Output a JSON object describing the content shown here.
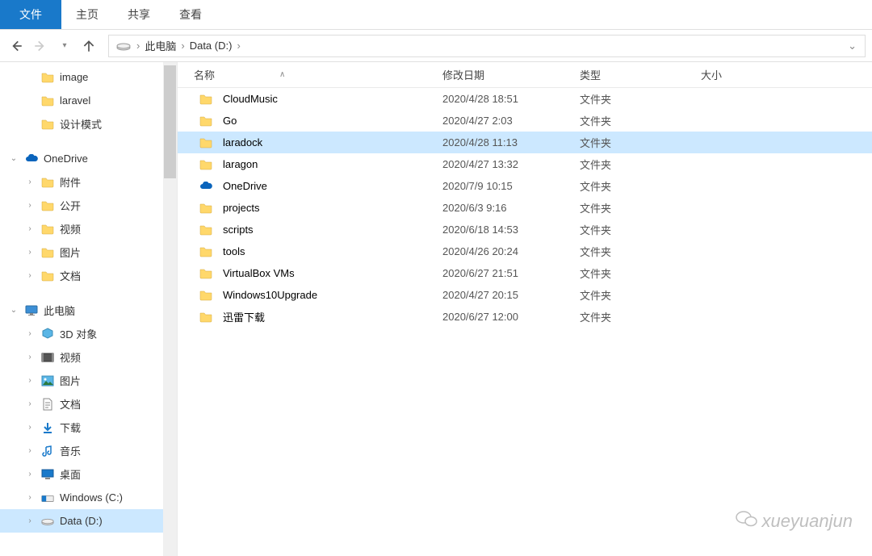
{
  "ribbon": {
    "file": "文件",
    "home": "主页",
    "share": "共享",
    "view": "查看"
  },
  "breadcrumb": {
    "root": "此电脑",
    "drive": "Data (D:)"
  },
  "sidebar": {
    "quick": {
      "items": [
        {
          "label": "image",
          "icon": "folder"
        },
        {
          "label": "laravel",
          "icon": "folder"
        },
        {
          "label": "设计模式",
          "icon": "folder"
        }
      ]
    },
    "onedrive": {
      "label": "OneDrive",
      "items": [
        {
          "label": "附件"
        },
        {
          "label": "公开"
        },
        {
          "label": "视频"
        },
        {
          "label": "图片"
        },
        {
          "label": "文档"
        }
      ]
    },
    "pc": {
      "label": "此电脑",
      "items": [
        {
          "label": "3D 对象",
          "icon": "3d"
        },
        {
          "label": "视频",
          "icon": "video"
        },
        {
          "label": "图片",
          "icon": "pictures"
        },
        {
          "label": "文档",
          "icon": "docs"
        },
        {
          "label": "下载",
          "icon": "downloads"
        },
        {
          "label": "音乐",
          "icon": "music"
        },
        {
          "label": "桌面",
          "icon": "desktop"
        },
        {
          "label": "Windows (C:)",
          "icon": "disk-c"
        },
        {
          "label": "Data (D:)",
          "icon": "disk-d",
          "selected": true
        }
      ]
    }
  },
  "columns": {
    "name": "名称",
    "date": "修改日期",
    "type": "类型",
    "size": "大小"
  },
  "files": [
    {
      "name": "CloudMusic",
      "date": "2020/4/28 18:51",
      "type": "文件夹",
      "icon": "folder"
    },
    {
      "name": "Go",
      "date": "2020/4/27 2:03",
      "type": "文件夹",
      "icon": "folder"
    },
    {
      "name": "laradock",
      "date": "2020/4/28 11:13",
      "type": "文件夹",
      "icon": "folder",
      "selected": true
    },
    {
      "name": "laragon",
      "date": "2020/4/27 13:32",
      "type": "文件夹",
      "icon": "folder"
    },
    {
      "name": "OneDrive",
      "date": "2020/7/9 10:15",
      "type": "文件夹",
      "icon": "onedrive"
    },
    {
      "name": "projects",
      "date": "2020/6/3 9:16",
      "type": "文件夹",
      "icon": "folder"
    },
    {
      "name": "scripts",
      "date": "2020/6/18 14:53",
      "type": "文件夹",
      "icon": "folder"
    },
    {
      "name": "tools",
      "date": "2020/4/26 20:24",
      "type": "文件夹",
      "icon": "folder"
    },
    {
      "name": "VirtualBox VMs",
      "date": "2020/6/27 21:51",
      "type": "文件夹",
      "icon": "folder"
    },
    {
      "name": "Windows10Upgrade",
      "date": "2020/4/27 20:15",
      "type": "文件夹",
      "icon": "folder"
    },
    {
      "name": "迅雷下载",
      "date": "2020/6/27 12:00",
      "type": "文件夹",
      "icon": "folder"
    }
  ],
  "watermark": "xueyuanjun"
}
